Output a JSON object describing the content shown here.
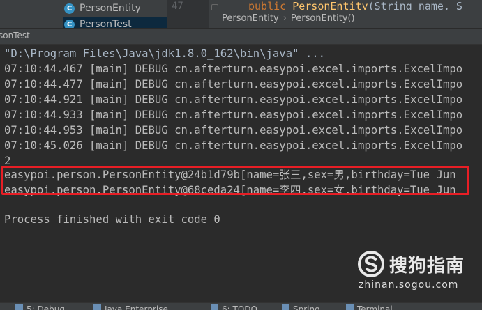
{
  "project_tree": {
    "items": [
      {
        "icon": "C",
        "label": "PersonEntity"
      },
      {
        "icon": "C",
        "label": "PersonTest"
      }
    ]
  },
  "editor": {
    "line_number": "47",
    "code": {
      "keyword": "public",
      "method": "PersonEntity",
      "params": "(String name, S"
    },
    "breadcrumb": [
      "PersonEntity",
      "PersonEntity()"
    ]
  },
  "run_panel": {
    "tab_label": "sonTest"
  },
  "console": {
    "command": "\"D:\\Program Files\\Java\\jdk1.8.0_162\\bin\\java\" ...",
    "lines": [
      "07:10:44.467 [main] DEBUG cn.afterturn.easypoi.excel.imports.ExcelImpo",
      "07:10:44.477 [main] DEBUG cn.afterturn.easypoi.excel.imports.ExcelImpo",
      "07:10:44.921 [main] DEBUG cn.afterturn.easypoi.excel.imports.ExcelImpo",
      "07:10:44.933 [main] DEBUG cn.afterturn.easypoi.excel.imports.ExcelImpo",
      "07:10:44.953 [main] DEBUG cn.afterturn.easypoi.excel.imports.ExcelImpo",
      "07:10:45.026 [main] DEBUG cn.afterturn.easypoi.excel.imports.ExcelImpo",
      "2",
      "easypoi.person.PersonEntity@24b1d79b[name=张三,sex=男,birthday=Tue Jun",
      "easypoi.person.PersonEntity@68ceda24[name=李四,sex=女,birthday=Tue Jun",
      "",
      "Process finished with exit code 0"
    ]
  },
  "watermark": {
    "brand": "搜狗指南",
    "url": "zhinan.sogou.com"
  },
  "bottom_toolbar": {
    "items": [
      "5: Debug",
      "Java Enterprise",
      "6: TODO",
      "Spring",
      "Terminal"
    ]
  },
  "colors": {
    "console_bg": "#2b2b2b",
    "panel_bg": "#3c3f41",
    "highlight_border": "#e81e25",
    "keyword": "#cc7832",
    "method": "#ffc66d"
  }
}
